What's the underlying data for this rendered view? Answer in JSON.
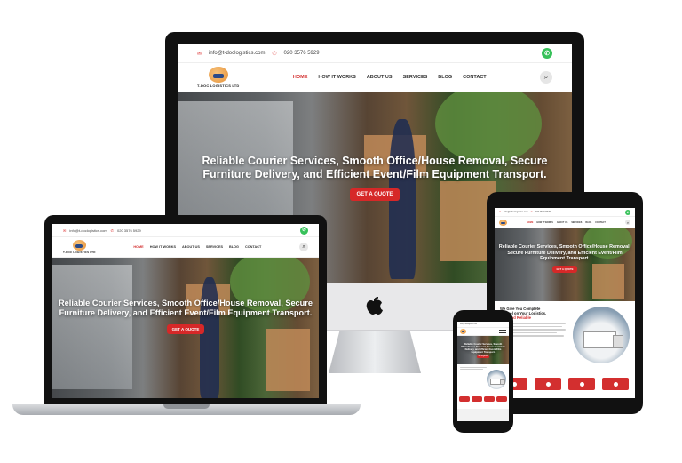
{
  "site": {
    "email": "info@t-doclogistics.com",
    "phone": "020 3576 5929",
    "logo_text": "T-DOC LOGISTICS LTD",
    "nav": [
      {
        "label": "HOME",
        "active": true
      },
      {
        "label": "HOW IT WORKS",
        "active": false
      },
      {
        "label": "ABOUT US",
        "active": false
      },
      {
        "label": "SERVICES",
        "active": false
      },
      {
        "label": "BLOG",
        "active": false
      },
      {
        "label": "CONTACT",
        "active": false
      }
    ],
    "hero_title": "Reliable Courier Services, Smooth Office/House Removal, Secure Furniture Delivery, and Efficient Event/Film Equipment Transport.",
    "cta_label": "GET A QUOTE",
    "about_heading_a": "We Give You Complete",
    "about_heading_b": "Control on Your Logistics,",
    "about_heading_c": "Fast And Reliable",
    "icons": {
      "email": "envelope-icon",
      "phone": "phone-icon",
      "whatsapp": "whatsapp-icon",
      "search": "search-icon"
    },
    "colors": {
      "accent": "#d32f2f",
      "whatsapp": "#37c15a"
    }
  }
}
